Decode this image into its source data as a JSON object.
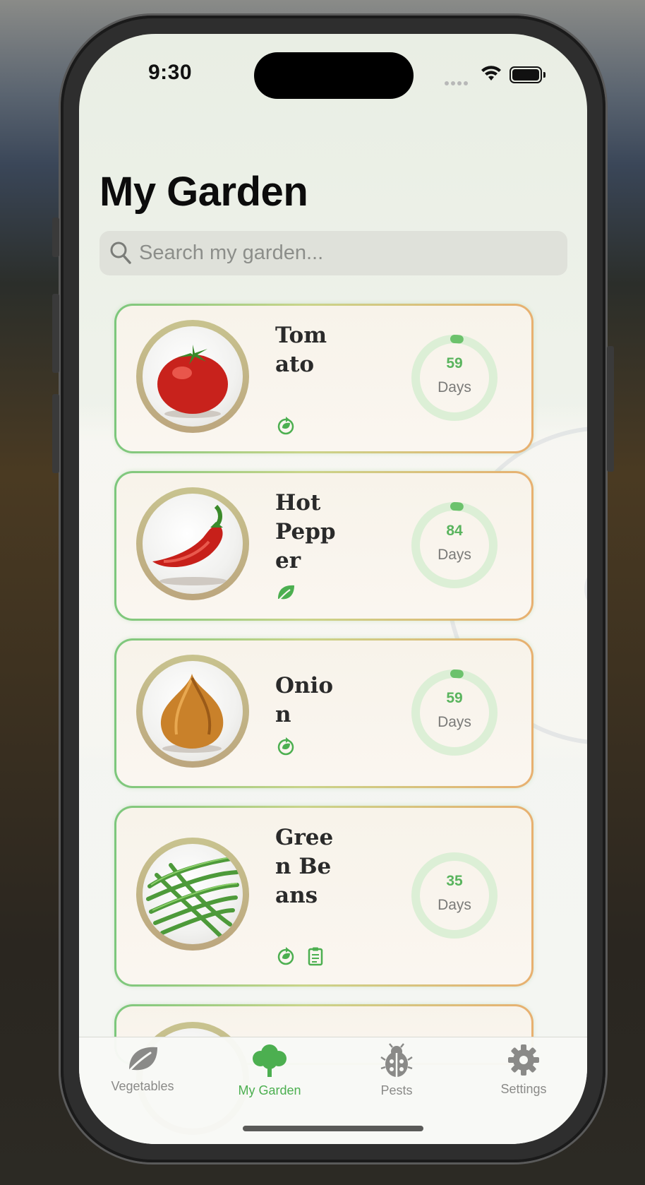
{
  "status_bar": {
    "time": "9:30"
  },
  "header": {
    "title": "My Garden"
  },
  "search": {
    "placeholder": "Search my garden..."
  },
  "garden": {
    "items": [
      {
        "name": "Tomato",
        "days": "59",
        "days_unit": "Days",
        "tags": [
          "recycle-icon"
        ],
        "progress": 0.02,
        "image": "tomato"
      },
      {
        "name": "Hot Pepper",
        "days": "84",
        "days_unit": "Days",
        "tags": [
          "leaf-icon"
        ],
        "progress": 0.02,
        "image": "hot-pepper"
      },
      {
        "name": "Onion",
        "days": "59",
        "days_unit": "Days",
        "tags": [
          "recycle-icon"
        ],
        "progress": 0.02,
        "image": "onion"
      },
      {
        "name": "Green Beans",
        "days": "35",
        "days_unit": "Days",
        "tags": [
          "recycle-icon",
          "clipboard-icon"
        ],
        "progress": 0.0,
        "image": "green-beans"
      }
    ]
  },
  "tab_bar": {
    "tabs": [
      {
        "label": "Vegetables",
        "icon": "leaf-icon",
        "active": false
      },
      {
        "label": "My Garden",
        "icon": "tree-icon",
        "active": true
      },
      {
        "label": "Pests",
        "icon": "ladybug-icon",
        "active": false
      },
      {
        "label": "Settings",
        "icon": "gear-icon",
        "active": false
      }
    ]
  },
  "colors": {
    "accent": "#4caf50",
    "inactive": "#8a8a88",
    "ring_track": "#dcefd6"
  }
}
